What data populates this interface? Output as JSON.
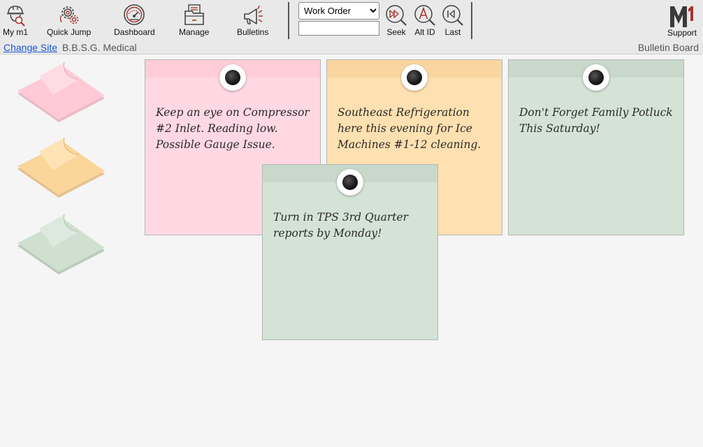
{
  "toolbar": {
    "my_m1": "My m1",
    "quick_jump": "Quick Jump",
    "dashboard": "Dashboard",
    "manage": "Manage",
    "bulletins": "Bulletins",
    "select_value": "Work Order",
    "seek": "Seek",
    "alt_id": "Alt ID",
    "last": "Last",
    "support": "Support",
    "logo_text": "M1"
  },
  "subbar": {
    "change_site": "Change Site",
    "site_name": "B.B.S.G. Medical",
    "title": "Bulletin Board"
  },
  "notes": [
    {
      "color": "pink",
      "text": "Keep an eye on Compressor #2 Inlet. Reading low. Possible Gauge Issue."
    },
    {
      "color": "orange",
      "text": "Southeast Refrigeration here this evening for Ice Machines #1-12 cleaning."
    },
    {
      "color": "green",
      "text": "Don't Forget Family Potluck This Saturday!"
    },
    {
      "color": "green",
      "text": "Turn in TPS 3rd Quarter reports by Monday!"
    }
  ],
  "pads": [
    {
      "name": "pink",
      "color": "#ffc9d6"
    },
    {
      "name": "orange",
      "color": "#fbd69b"
    },
    {
      "name": "green",
      "color": "#cfe0d0"
    }
  ],
  "colors": {
    "icon_red": "#a8322d",
    "icon_dark": "#444444",
    "link": "#1a55d6"
  }
}
